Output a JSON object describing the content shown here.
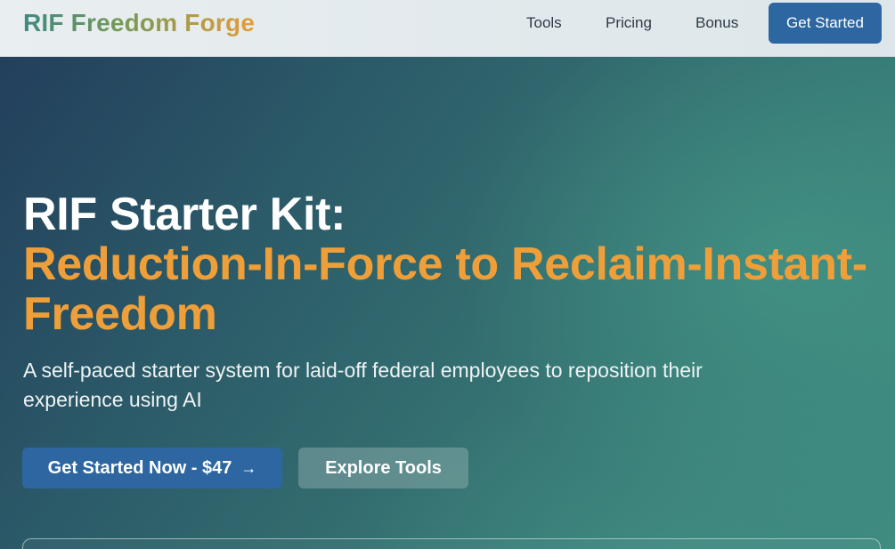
{
  "nav": {
    "brand": "RIF Freedom Forge",
    "links": [
      {
        "label": "Tools"
      },
      {
        "label": "Pricing"
      },
      {
        "label": "Bonus"
      }
    ],
    "cta_label": "Get Started"
  },
  "hero": {
    "title_line1": "RIF Starter Kit:",
    "title_accent": "Reduction-In-Force to Reclaim-Instant-Freedom",
    "subtitle": "A self-paced starter system for laid-off federal employees to reposition their experience using AI",
    "primary_button_label": "Get Started Now - $47",
    "primary_button_icon": "arrow-right-icon",
    "secondary_button_label": "Explore Tools"
  },
  "colors": {
    "accent_orange": "#ee9f3a",
    "button_blue": "#2d66a0",
    "hero_teal": "#3e8a80",
    "hero_navy": "#233f5c"
  }
}
